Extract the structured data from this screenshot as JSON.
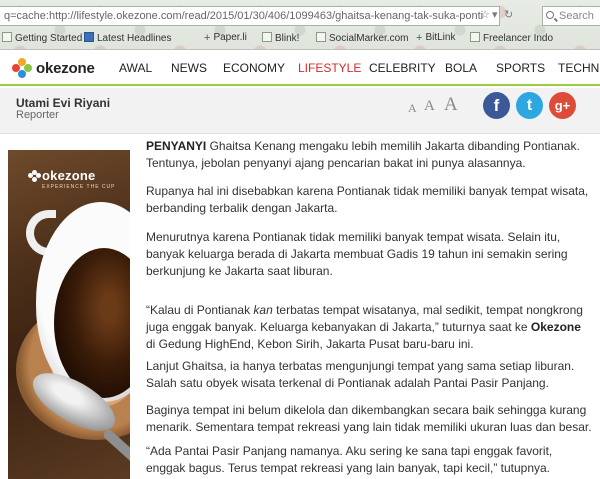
{
  "browser": {
    "url": "q=cache:http://lifestyle.okezone.com/read/2015/01/30/406/1099463/ghaitsa-kenang-tak-suka-ponti",
    "search_placeholder": "Search",
    "bookmarks": [
      {
        "label": "Getting Started",
        "icon": "page-icon"
      },
      {
        "label": "Latest Headlines",
        "icon": "rss-icon"
      },
      {
        "label": "Paper.li",
        "icon": "plus-icon"
      },
      {
        "label": "Blink!",
        "icon": "page-icon"
      },
      {
        "label": "SocialMarker.com",
        "icon": "page-icon"
      },
      {
        "label": "BitLink",
        "icon": "plus-icon"
      },
      {
        "label": "Freelancer Indo",
        "icon": "page-icon"
      }
    ]
  },
  "site": {
    "logo_text": "okezone",
    "nav": [
      "AWAL",
      "NEWS",
      "ECONOMY",
      "LIFESTYLE",
      "CELEBRITY",
      "BOLA",
      "SPORTS",
      "TECHNO"
    ],
    "active_nav": "LIFESTYLE",
    "colors": {
      "accent_green": "#9ccc3c",
      "active_red": "#d22d2d",
      "facebook": "#3b5998",
      "twitter": "#2ea7e0",
      "googleplus": "#dd4b39"
    }
  },
  "author": {
    "name": "Utami Evi Riyani",
    "role": "Reporter",
    "font_size_controls": [
      "A",
      "A",
      "A"
    ],
    "social": [
      "f",
      "t",
      "g+"
    ]
  },
  "ad": {
    "logo_text": "okezone",
    "tagline": "EXPERIENCE THE CUP"
  },
  "article": {
    "p1_lead": "PENYANYI",
    "p1_text": " Ghaitsa Kenang mengaku lebih memilih Jakarta dibanding Pontianak. Tentunya, jebolan penyanyi ajang pencarian bakat ini punya alasannya.",
    "p2": "Rupanya hal ini disebabkan karena Pontianak tidak memiliki banyak tempat wisata, berbanding terbalik dengan Jakarta.",
    "p3": "Menurutnya karena Pontianak tidak memiliki banyak tempat wisata. Selain itu, banyak keluarga berada di Jakarta membuat Gadis 19 tahun ini semakin sering berkunjung ke Jakarta saat liburan.",
    "p4_a": "“Kalau di Pontianak ",
    "p4_em": "kan",
    "p4_b": " terbatas tempat wisatanya, mal sedikit, tempat nongkrong juga enggak banyak. Keluarga kebanyakan di Jakarta,” tuturnya saat ke ",
    "p4_bold": "Okezone",
    "p4_c": " di Gedung HighEnd, Kebon Sirih, Jakarta Pusat baru-baru ini.",
    "p5": "Lanjut Ghaitsa, ia hanya terbatas mengunjungi tempat yang sama setiap liburan. Salah satu obyek wisata terkenal di Pontianak adalah Pantai Pasir Panjang.",
    "p6": "Baginya tempat ini belum dikelola dan dikembangkan secara baik sehingga kurang menarik. Sementara tempat rekreasi yang lain tidak memiliki ukuran luas dan besar.",
    "p7": "“Ada Pantai Pasir Panjang namanya. Aku sering ke sana tapi enggak favorit, enggak bagus. Terus tempat rekreasi yang lain banyak, tapi kecil,” tutupnya."
  }
}
